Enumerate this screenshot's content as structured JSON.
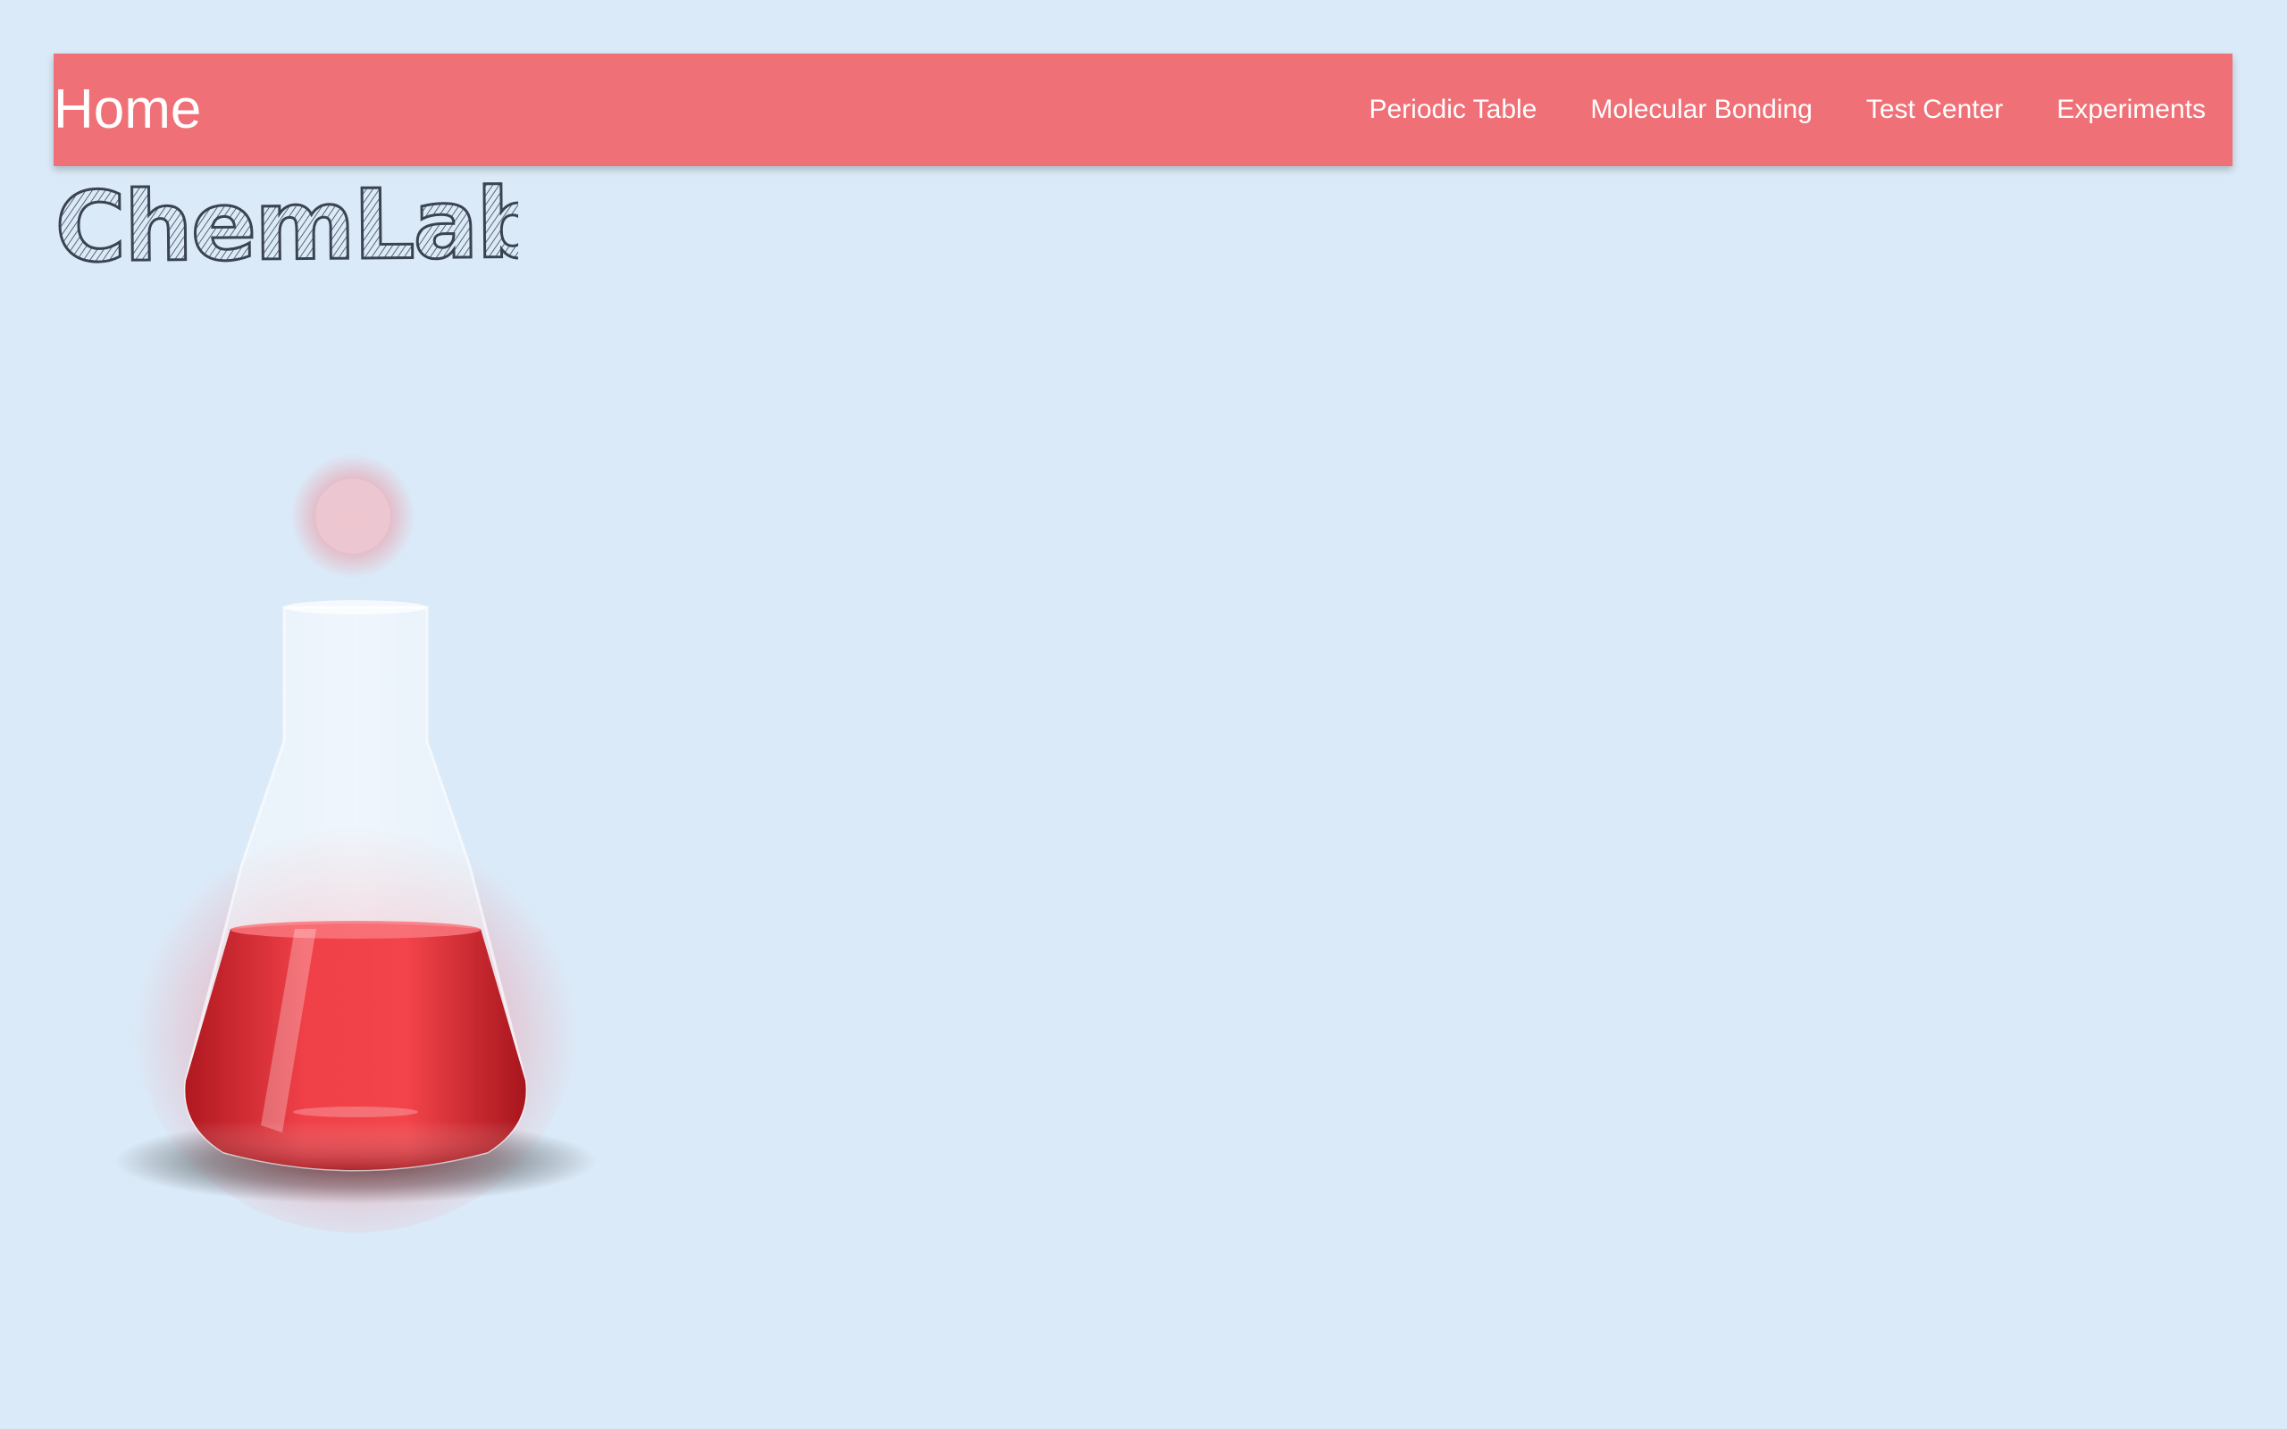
{
  "header": {
    "brand": "Home",
    "nav": [
      {
        "label": "Periodic Table"
      },
      {
        "label": "Molecular Bonding"
      },
      {
        "label": "Test Center"
      },
      {
        "label": "Experiments"
      }
    ]
  },
  "logo": {
    "text": "ChemLab"
  },
  "hero": {
    "icon": "flask-icon",
    "liquid_color": "#e8343a"
  },
  "colors": {
    "background": "#dbeaf8",
    "navbar": "#f07077",
    "logo_ink": "#3a4350"
  }
}
